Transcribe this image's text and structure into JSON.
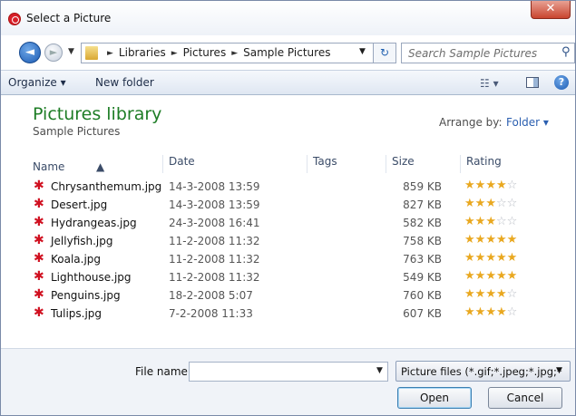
{
  "window": {
    "title": "Select a Picture",
    "close_glyph": "✕"
  },
  "navigation": {
    "back_glyph": "◄",
    "forward_glyph": "►",
    "breadcrumb": [
      "Libraries",
      "Pictures",
      "Sample Pictures"
    ],
    "separator": "►",
    "dropdown_glyph": "▼",
    "refresh_glyph": "↻",
    "search_placeholder": "Search Sample Pictures"
  },
  "toolbar": {
    "organize_label": "Organize ▾",
    "new_folder_label": "New folder",
    "view_glyph": "☷ ▾",
    "help_glyph": "?"
  },
  "library": {
    "title": "Pictures library",
    "subtitle": "Sample Pictures",
    "arrange_label": "Arrange by:",
    "arrange_value": "Folder ▾"
  },
  "columns": {
    "name": "Name",
    "date": "Date",
    "tags": "Tags",
    "size": "Size",
    "rating": "Rating"
  },
  "files": [
    {
      "name": "Chrysanthemum.jpg",
      "date": "14-3-2008 13:59",
      "size": "859 KB",
      "rating": "★★★★☆",
      "stars": 4
    },
    {
      "name": "Desert.jpg",
      "date": "14-3-2008 13:59",
      "size": "827 KB",
      "rating": "★★★☆☆",
      "stars": 3
    },
    {
      "name": "Hydrangeas.jpg",
      "date": "24-3-2008 16:41",
      "size": "582 KB",
      "rating": "★★★☆☆",
      "stars": 3
    },
    {
      "name": "Jellyfish.jpg",
      "date": "11-2-2008 11:32",
      "size": "758 KB",
      "rating": "★★★★★",
      "stars": 5
    },
    {
      "name": "Koala.jpg",
      "date": "11-2-2008 11:32",
      "size": "763 KB",
      "rating": "★★★★★",
      "stars": 5
    },
    {
      "name": "Lighthouse.jpg",
      "date": "11-2-2008 11:32",
      "size": "549 KB",
      "rating": "★★★★★",
      "stars": 5
    },
    {
      "name": "Penguins.jpg",
      "date": "18-2-2008 5:07",
      "size": "760 KB",
      "rating": "★★★★☆",
      "stars": 4
    },
    {
      "name": "Tulips.jpg",
      "date": "7-2-2008 11:33",
      "size": "607 KB",
      "rating": "★★★★☆",
      "stars": 4
    }
  ],
  "footer": {
    "filename_label": "File name:",
    "filename_value": "",
    "filter_label": "Picture files (*.gif;*.jpeg;*.jpg;*",
    "open_label": "Open",
    "cancel_label": "Cancel"
  },
  "colors": {
    "library_title": "#1e7d26",
    "link_blue": "#2b5fb0",
    "star_on": "#e9a820",
    "star_off": "#b8bcc4",
    "file_icon": "#d01020"
  },
  "icons": [
    "app-icon",
    "back-arrow-icon",
    "forward-arrow-icon",
    "folder-icon",
    "refresh-icon",
    "search-icon",
    "view-icon",
    "preview-pane-icon",
    "help-icon",
    "picture-file-icon",
    "star-icon"
  ]
}
